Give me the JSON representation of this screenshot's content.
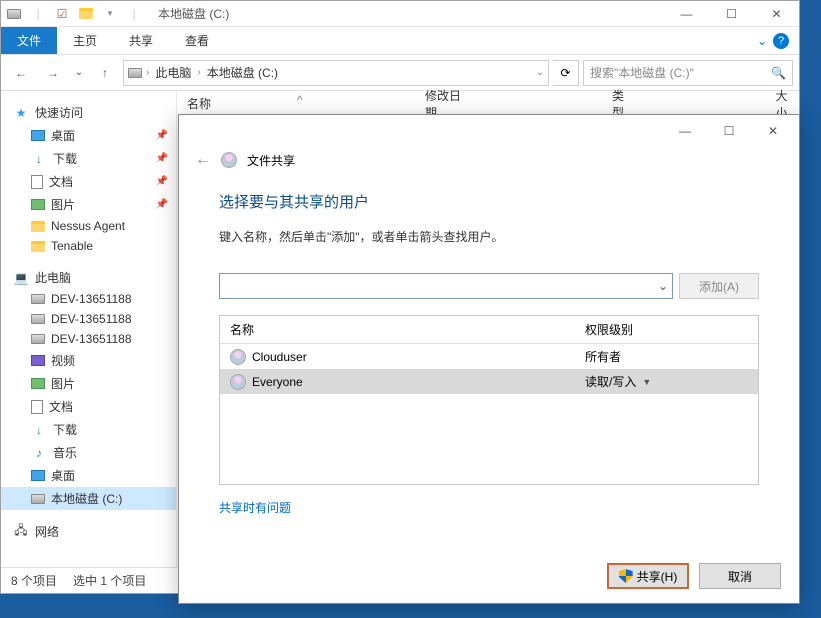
{
  "titlebar": {
    "title": "本地磁盘 (C:)"
  },
  "win": {
    "min": "—",
    "max": "☐",
    "close": "✕"
  },
  "ribbon": {
    "file": "文件",
    "home": "主页",
    "share": "共享",
    "view": "查看",
    "collapse": "⌄",
    "help": "?"
  },
  "nav": {
    "back": "←",
    "fwd": "→",
    "down": "⌄",
    "up": "↑",
    "refresh": "⟳"
  },
  "address": {
    "root_icon": "💻",
    "seg1": "此电脑",
    "seg2": "本地磁盘 (C:)",
    "chev": "›",
    "dropdown": "⌄"
  },
  "search": {
    "placeholder": "搜索\"本地磁盘 (C:)\"",
    "icon": "🔍"
  },
  "columns": {
    "name": "名称",
    "date": "修改日期",
    "type": "类型",
    "size": "大小",
    "sort": "^"
  },
  "tree": {
    "quick": "快速访问",
    "desktop": "桌面",
    "downloads": "下载",
    "documents": "文档",
    "pictures": "图片",
    "nessus": "Nessus Agent",
    "tenable": "Tenable",
    "thispc": "此电脑",
    "dev1": "DEV-13651188",
    "dev2": "DEV-13651188",
    "dev3": "DEV-13651188",
    "videos": "视频",
    "pictures2": "图片",
    "documents2": "文档",
    "downloads2": "下载",
    "music": "音乐",
    "desktop2": "桌面",
    "cdrive": "本地磁盘 (C:)",
    "network": "网络"
  },
  "status": {
    "items": "8 个项目",
    "selected": "选中 1 个项目"
  },
  "dialog": {
    "back": "←",
    "title": "文件共享",
    "heading": "选择要与其共享的用户",
    "subtitle": "键入名称，然后单击\"添加\"，或者单击箭头查找用户。",
    "combo_chev": "⌄",
    "add": "添加(A)",
    "col_name": "名称",
    "col_perm": "权限级别",
    "rows": [
      {
        "name": "Clouduser",
        "perm": "所有者",
        "selected": false
      },
      {
        "name": "Everyone",
        "perm": "读取/写入",
        "dropdown": "▼",
        "selected": true
      }
    ],
    "issues": "共享时有问题",
    "share_btn": "共享(H)",
    "cancel_btn": "取消"
  }
}
